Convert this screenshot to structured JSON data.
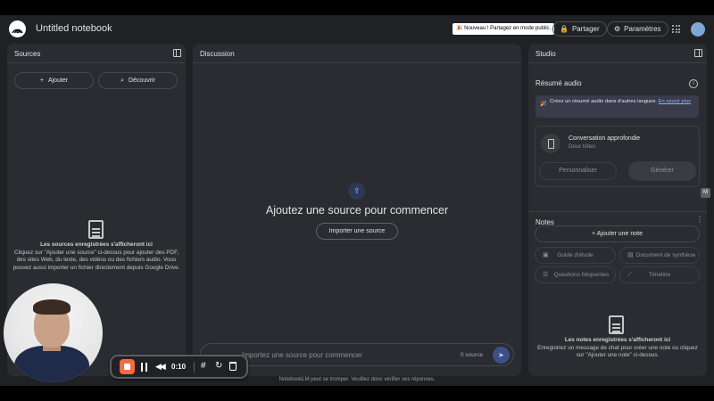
{
  "header": {
    "title": "Untitled notebook",
    "announcement": "🎉 Nouveau ! Partagez en mode public.",
    "share_label": "Partager",
    "settings_label": "Paramètres",
    "icons": [
      "notebooklm-logo-icon",
      "lock-icon",
      "gear-icon",
      "apps-grid-icon",
      "avatar"
    ]
  },
  "sources": {
    "title": "Sources",
    "add_label": "Ajouter",
    "discover_label": "Découvrir",
    "empty_title": "Les sources enregistrées s'afficheront ici",
    "empty_body": "Cliquez sur \"Ajouter une source\" ci-dessus pour ajouter des PDF, des sites Web, du texte, des vidéos ou des fichiers audio. Vous pouvez aussi importer un fichier directement depuis Google Drive."
  },
  "discussion": {
    "title": "Discussion",
    "heading": "Ajoutez une source pour commencer",
    "import_label": "Importer une source",
    "input_placeholder": "Importez une source pour commencer",
    "source_count": "0 source"
  },
  "studio": {
    "title": "Studio",
    "audio_title": "Résumé audio",
    "promo_text": "Créez un résumé audio dans d'autres langues.",
    "promo_link": "En savoir plus",
    "convo_title": "Conversation approfondie",
    "convo_sub": "Deux hôtes",
    "customize_label": "Personnaliser",
    "generate_label": "Générer",
    "notes_title": "Notes",
    "add_note_label": "Ajouter une note",
    "chips": {
      "study_guide": "Guide d'étude",
      "briefing_doc": "Document de synthèse",
      "faq": "Questions fréquentes",
      "timeline": "Timeline"
    },
    "empty_title": "Les notes enregistrées s'afficheront ici",
    "empty_body": "Enregistrez un message de chat pour créer une note ou cliquez sur \"Ajouter une note\" ci-dessus."
  },
  "footer": {
    "disclaimer": "NotebookLM peut se tromper. Veuillez donc vérifier ses réponses."
  },
  "recorder": {
    "time": "0:10"
  },
  "colors": {
    "background": "#1f2125",
    "panel": "#2a2c31",
    "accent": "#8ab4f8",
    "record": "#f56b42"
  }
}
